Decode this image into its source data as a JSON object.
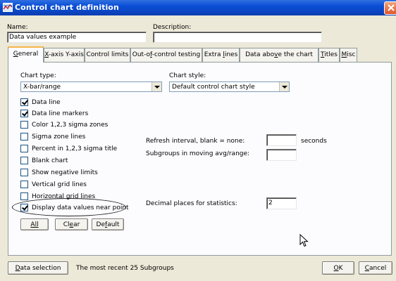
{
  "window": {
    "title": "Control chart definition",
    "icon": "chart-icon"
  },
  "header": {
    "name_label": "Name:",
    "name_value": "Data values example",
    "description_label": "Description:",
    "description_value": ""
  },
  "tabs": [
    {
      "label": "General",
      "mnemonic": "G",
      "rest": "eneral",
      "active": true
    },
    {
      "label": "X-axis Y-axis",
      "mnemonic": "X",
      "rest": "-axis Y-axis"
    },
    {
      "label": "Control limits"
    },
    {
      "label": "Out-of-control testing",
      "pre": "Out-o",
      "mnemonic": "f",
      "rest": "-control testing"
    },
    {
      "label": "Extra lines",
      "pre": "Extra ",
      "mnemonic": "l",
      "rest": "ines"
    },
    {
      "label": "Data above the chart",
      "pre": "Data abo",
      "mnemonic": "v",
      "rest": "e the chart"
    },
    {
      "label": "Titles",
      "mnemonic": "T",
      "rest": "itles"
    },
    {
      "label": "Misc",
      "mnemonic": "M",
      "rest": "isc"
    }
  ],
  "general": {
    "chart_type_label": "Chart type:",
    "chart_type_value": "X-bar/range",
    "chart_style_label": "Chart style:",
    "chart_style_value": "Default control chart style",
    "checkboxes": [
      {
        "label": "Data line",
        "checked": true
      },
      {
        "label": "Data line markers",
        "checked": true
      },
      {
        "label": "Color 1,2,3 sigma zones",
        "checked": false
      },
      {
        "label": "Sigma zone lines",
        "checked": false
      },
      {
        "label": "Percent in 1,2,3 sigma title",
        "checked": false
      },
      {
        "label": "Blank chart",
        "checked": false
      },
      {
        "label": "Show negative limits",
        "checked": false
      },
      {
        "label": "Vertical grid lines",
        "checked": false
      },
      {
        "label": "Horizontal grid lines",
        "checked": false
      },
      {
        "label": "Display data values near point",
        "checked": true
      }
    ],
    "refresh_label": "Refresh interval, blank = none:",
    "refresh_value": "",
    "refresh_unit": "seconds",
    "subgroups_label": "Subgroups in moving avg/range:",
    "subgroups_value": "",
    "decimals_label": "Decimal places for statistics:",
    "decimals_value": "2",
    "btn_all": "All",
    "btn_clear_pre": "Cl",
    "btn_clear_mn": "e",
    "btn_clear_rest": "ar",
    "btn_default_pre": "De",
    "btn_default_mn": "f",
    "btn_default_rest": "ault"
  },
  "footer": {
    "data_selection_mn": "D",
    "data_selection_rest": "ata selection",
    "status": "The most recent 25 Subgroups",
    "ok_mn": "O",
    "ok_rest": "K",
    "cancel_mn": "C",
    "cancel_rest": "ancel"
  }
}
